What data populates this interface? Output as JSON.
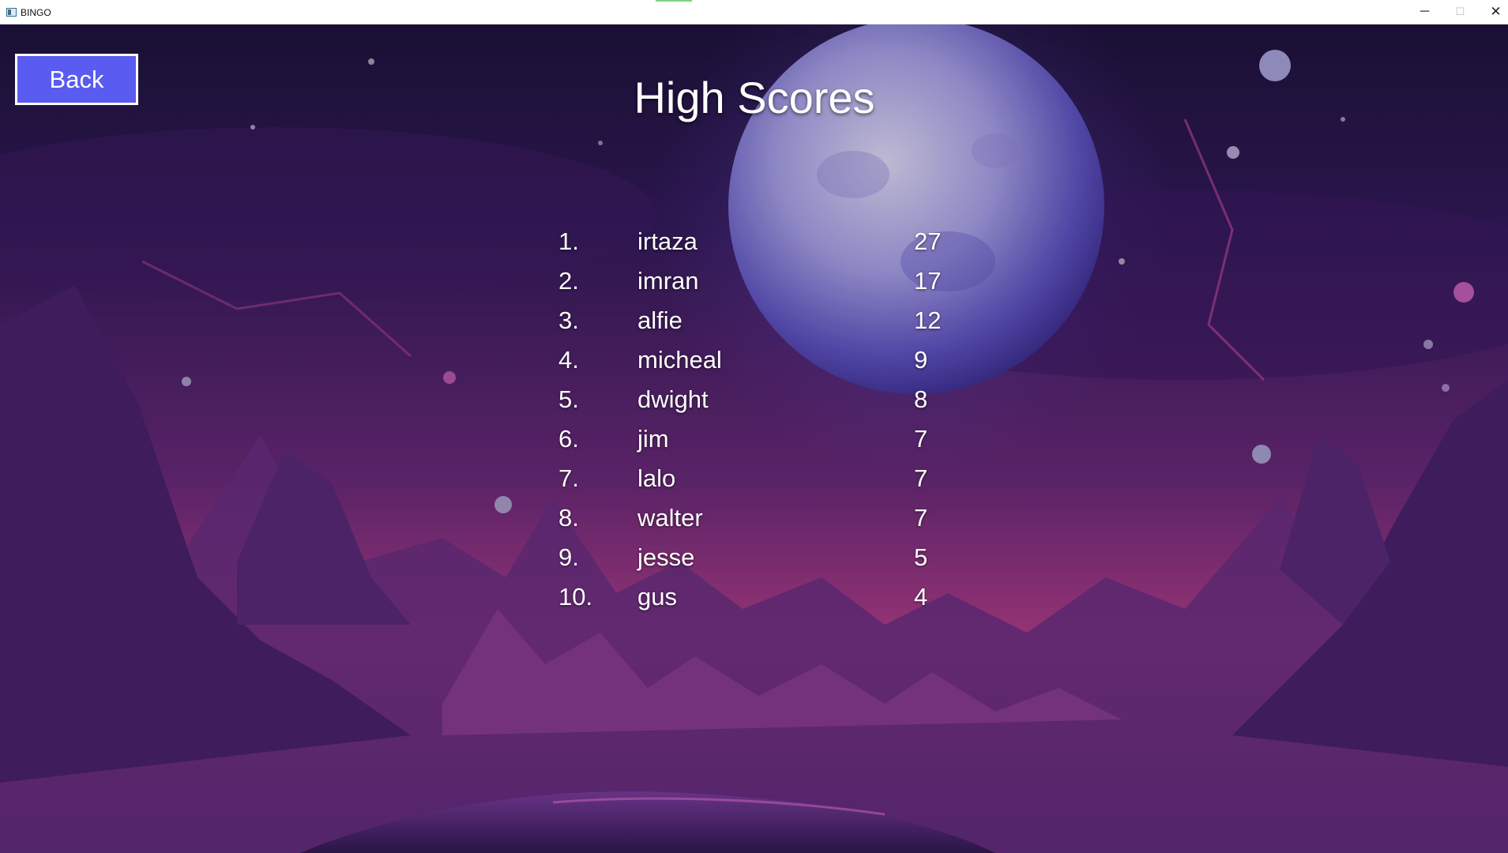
{
  "window": {
    "title": "BINGO",
    "minimize_glyph": "─",
    "maximize_glyph": "☐",
    "close_glyph": "✕"
  },
  "back_button": {
    "label": "Back"
  },
  "page": {
    "title": "High Scores"
  },
  "scores": [
    {
      "rank": "1.",
      "name": "irtaza",
      "score": "27"
    },
    {
      "rank": "2.",
      "name": "imran",
      "score": "17"
    },
    {
      "rank": "3.",
      "name": "alfie",
      "score": "12"
    },
    {
      "rank": "4.",
      "name": "micheal",
      "score": "9"
    },
    {
      "rank": "5.",
      "name": "dwight",
      "score": "8"
    },
    {
      "rank": "6.",
      "name": "jim",
      "score": "7"
    },
    {
      "rank": "7.",
      "name": "lalo",
      "score": "7"
    },
    {
      "rank": "8.",
      "name": "walter",
      "score": "7"
    },
    {
      "rank": "9.",
      "name": "jesse",
      "score": "5"
    },
    {
      "rank": "10.",
      "name": "gus",
      "score": "4"
    }
  ],
  "colors": {
    "back_button_bg": "#5a5bf1",
    "text": "#ffffff",
    "sky_top": "#1c1236",
    "sky_horizon": "#c23f88",
    "moon": "#c9c6ef"
  }
}
